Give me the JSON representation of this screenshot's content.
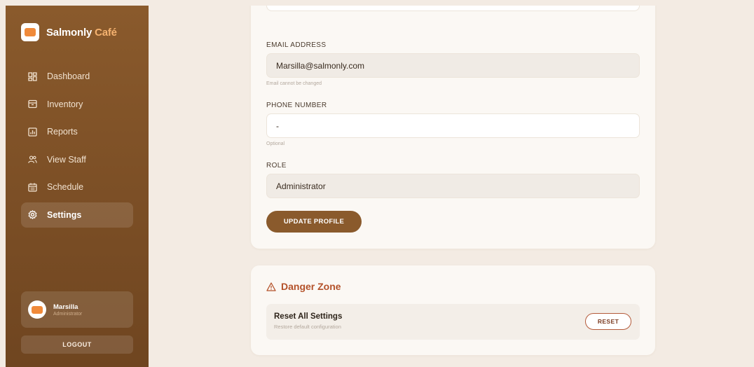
{
  "brand": {
    "name_main": "Salmonly",
    "name_accent": "Café"
  },
  "sidebar": {
    "items": [
      {
        "label": "Dashboard",
        "icon": "dashboard-grid-icon"
      },
      {
        "label": "Inventory",
        "icon": "archive-box-icon"
      },
      {
        "label": "Reports",
        "icon": "report-chart-icon"
      },
      {
        "label": "View Staff",
        "icon": "users-icon"
      },
      {
        "label": "Schedule",
        "icon": "calendar-icon"
      },
      {
        "label": "Settings",
        "icon": "gear-icon",
        "active": true
      }
    ]
  },
  "user": {
    "name": "Marsilla",
    "role": "Administrator"
  },
  "logout_label": "LOGOUT",
  "profile": {
    "email_label": "EMAIL ADDRESS",
    "email_value": "Marsilla@salmonly.com",
    "email_helper": "Email cannot be changed",
    "phone_label": "PHONE NUMBER",
    "phone_value": "-",
    "phone_helper": "Optional",
    "role_label": "ROLE",
    "role_value": "Administrator",
    "update_button": "UPDATE PROFILE"
  },
  "danger_zone": {
    "title": "Danger Zone",
    "reset_title": "Reset All Settings",
    "reset_subtitle": "Restore default configuration",
    "reset_button": "RESET"
  },
  "colors": {
    "sidebar": "#8a5a2c",
    "accent": "#f5b270",
    "danger": "#b4522a",
    "background": "#f3ebe3"
  }
}
